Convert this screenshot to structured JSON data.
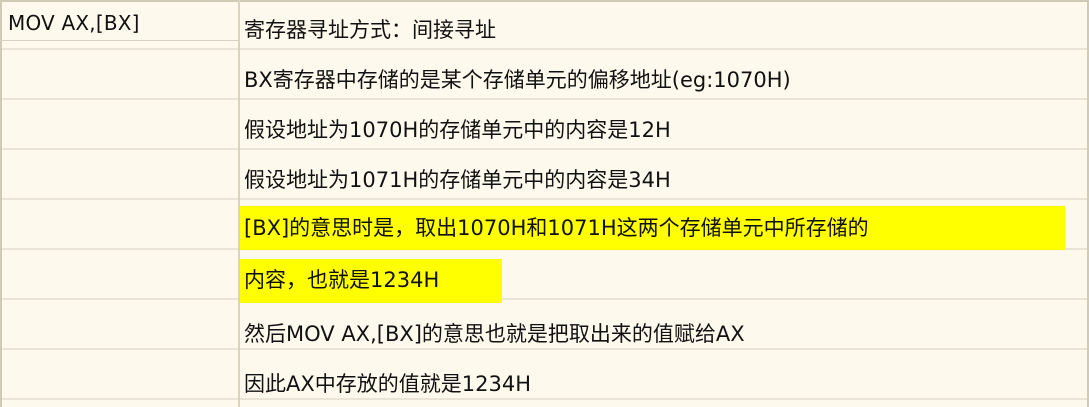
{
  "left": {
    "instruction": "MOV AX,[BX]"
  },
  "notes": [
    "寄存器寻址方式：间接寻址",
    "BX寄存器中存储的是某个存储单元的偏移地址(eg:1070H)",
    "假设地址为1070H的存储单元中的内容是12H",
    "假设地址为1071H的存储单元中的内容是34H",
    "[BX]的意思时是，取出1070H和1071H这两个存储单元中所存储的",
    "内容，也就是1234H",
    "然后MOV AX,[BX]的意思也就是把取出来的值赋给AX",
    "因此AX中存放的值就是1234H"
  ],
  "highlight_color": "#ffff00"
}
